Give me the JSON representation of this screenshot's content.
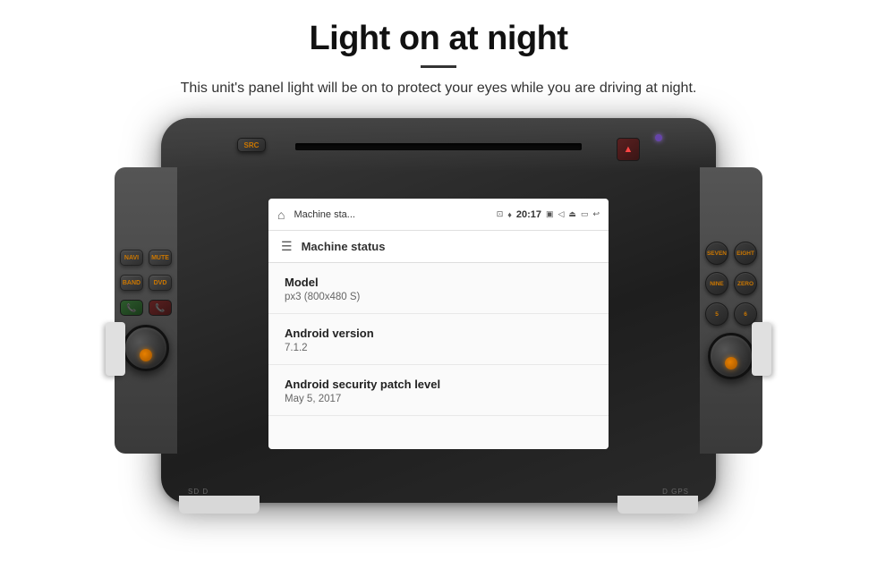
{
  "page": {
    "title": "Light on at night",
    "divider": true,
    "subtitle": "This unit's panel light will be on to protect your eyes while you are driving at night."
  },
  "buttons": {
    "src": "SRC",
    "navi": "NAVI",
    "mute": "MUTE",
    "band": "BAND",
    "dvd": "DVD",
    "seven": "SEVEN",
    "eight": "EIGHT",
    "nine": "NINE",
    "zero": "ZERO",
    "five": "5",
    "six": "6"
  },
  "bottom_labels": {
    "left": "SD D",
    "right": "D GPS"
  },
  "android": {
    "statusbar": {
      "title": "Machine sta...",
      "time": "20:17"
    },
    "header": {
      "title": "Machine status"
    },
    "rows": [
      {
        "label": "Model",
        "value": "px3 (800x480 S)"
      },
      {
        "label": "Android version",
        "value": "7.1.2"
      },
      {
        "label": "Android security patch level",
        "value": "May 5, 2017"
      }
    ]
  }
}
